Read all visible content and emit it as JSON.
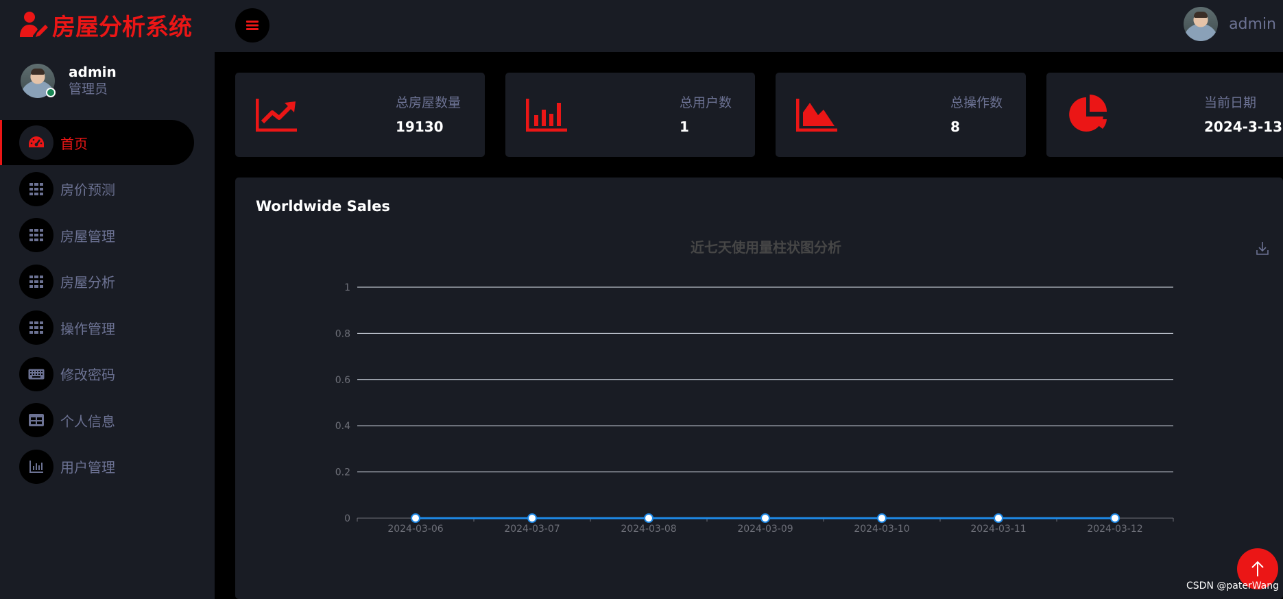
{
  "brand": {
    "title": "房屋分析系统"
  },
  "sidebar": {
    "user_name": "admin",
    "user_role": "管理员",
    "items": [
      {
        "label": "首页",
        "icon": "dashboard-icon",
        "active": true
      },
      {
        "label": "房价预测",
        "icon": "grid-icon"
      },
      {
        "label": "房屋管理",
        "icon": "grid-icon"
      },
      {
        "label": "房屋分析",
        "icon": "grid-icon"
      },
      {
        "label": "操作管理",
        "icon": "grid-icon"
      },
      {
        "label": "修改密码",
        "icon": "keyboard-icon"
      },
      {
        "label": "个人信息",
        "icon": "table-icon"
      },
      {
        "label": "用户管理",
        "icon": "bar-chart-icon"
      }
    ]
  },
  "topbar": {
    "user_name": "admin"
  },
  "stats": [
    {
      "label": "总房屋数量",
      "value": "19130",
      "icon": "line-chart-icon"
    },
    {
      "label": "总用户数",
      "value": "1",
      "icon": "bar-chart-icon"
    },
    {
      "label": "总操作数",
      "value": "8",
      "icon": "area-chart-icon"
    },
    {
      "label": "当前日期",
      "value": "2024-3-13",
      "icon": "pie-chart-icon"
    }
  ],
  "panel": {
    "title": "Worldwide Sales"
  },
  "chart_data": {
    "type": "line",
    "title": "近七天使用量柱状图分析",
    "categories": [
      "2024-03-06",
      "2024-03-07",
      "2024-03-08",
      "2024-03-09",
      "2024-03-10",
      "2024-03-11",
      "2024-03-12"
    ],
    "series": [
      {
        "values": [
          0,
          0,
          0,
          0,
          0,
          0,
          0
        ]
      }
    ],
    "yticks": [
      "0",
      "0.2",
      "0.4",
      "0.6",
      "0.8",
      "1"
    ],
    "ylim": [
      0,
      1
    ],
    "grid": true,
    "colors": {
      "line": "#1e88e5",
      "grid": "#e0e6f1"
    }
  },
  "colors": {
    "accent": "#eb1616",
    "panel": "#191c24",
    "muted": "#6c7293"
  },
  "watermark": "CSDN @paterWang"
}
